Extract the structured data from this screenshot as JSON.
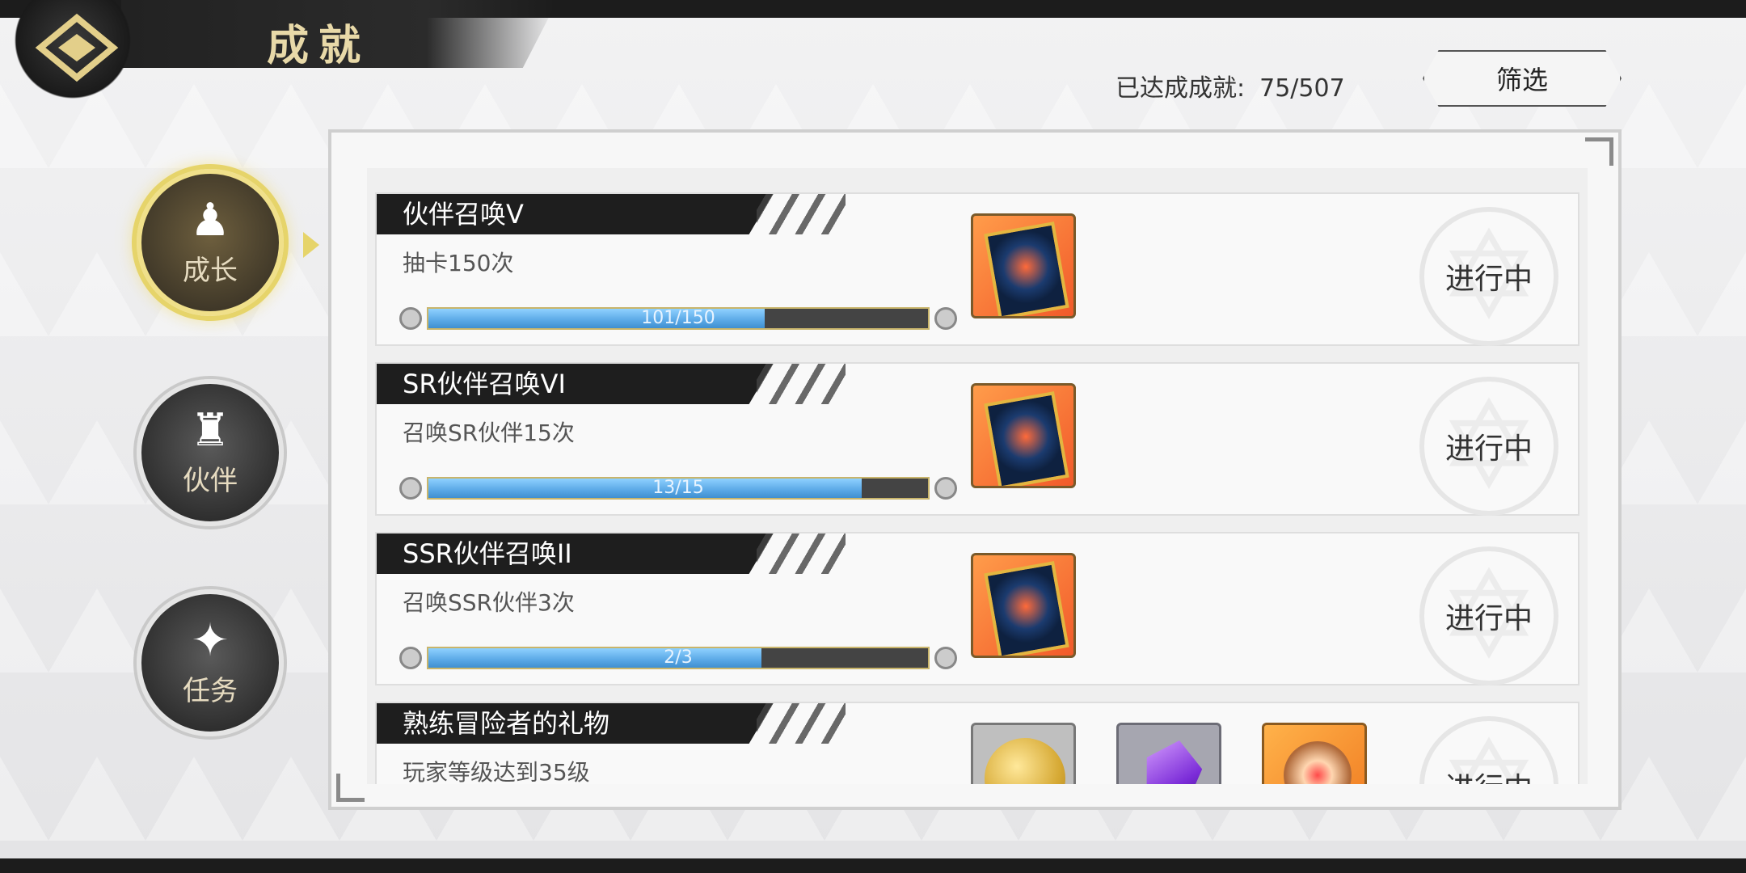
{
  "header": {
    "title": "成就",
    "back_icon": "back-diamond-icon"
  },
  "summary": {
    "label": "已达成成就:",
    "value": "75/507"
  },
  "filter": {
    "label": "筛选"
  },
  "tabs": [
    {
      "label": "成长",
      "icon": "hooded-figure-icon",
      "active": true
    },
    {
      "label": "伙伴",
      "icon": "party-icon",
      "active": false
    },
    {
      "label": "任务",
      "icon": "book-flame-icon",
      "active": false
    }
  ],
  "achievements": [
    {
      "title": "伙伴召唤V",
      "desc": "抽卡150次",
      "progress_text": "101/150",
      "progress_fraction": 0.673,
      "rewards": [
        "summon-card"
      ],
      "status": "进行中"
    },
    {
      "title": "SR伙伴召唤VI",
      "desc": "召唤SR伙伴15次",
      "progress_text": "13/15",
      "progress_fraction": 0.867,
      "rewards": [
        "summon-card"
      ],
      "status": "进行中"
    },
    {
      "title": "SSR伙伴召唤II",
      "desc": "召唤SSR伙伴3次",
      "progress_text": "2/3",
      "progress_fraction": 0.667,
      "rewards": [
        "summon-card"
      ],
      "status": "进行中"
    },
    {
      "title": "熟练冒险者的礼物",
      "desc": "玩家等级达到35级",
      "progress_text": "",
      "progress_fraction": 0,
      "rewards": [
        "gold-coin",
        "purple-gem",
        "orange-item"
      ],
      "status": "进行中"
    }
  ]
}
